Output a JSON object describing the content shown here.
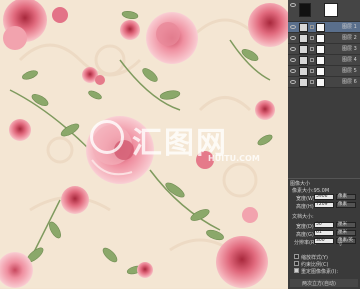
{
  "watermark": {
    "text": "汇图网",
    "url": "HUITU.COM"
  },
  "layers": {
    "items": [
      {
        "name": "图层 0"
      },
      {
        "name": "图层 1"
      },
      {
        "name": "图层 2"
      },
      {
        "name": "图层 3"
      },
      {
        "name": "图层 4"
      },
      {
        "name": "图层 5"
      },
      {
        "name": "图层 6"
      }
    ]
  },
  "image_size": {
    "title": "图像大小",
    "pixel_dims": "像素大小:95.0M",
    "width_label": "宽度(W):",
    "width_value": "5906",
    "height_label": "高度(H):",
    "height_value": "7209",
    "unit_pixels": "像素",
    "doc_size": "文档大小:",
    "doc_width_label": "宽度(D):",
    "doc_width_value": "50",
    "doc_height_label": "高度(G):",
    "doc_height_value": "61",
    "resolution_label": "分辨率(R):",
    "resolution_value": "300",
    "unit_cm": "厘米",
    "unit_ppi": "像素/英寸",
    "scale_styles": "缩放样式(Y)",
    "constrain": "约束比例(C)",
    "resample": "重定图像像素(I):",
    "resample_method": "两次立方(自动)"
  },
  "colors": {
    "panel": "#3d3d3d",
    "canvas": "#f4e6d3",
    "rose": "#e57a8a",
    "leaf": "#8ba86a"
  }
}
